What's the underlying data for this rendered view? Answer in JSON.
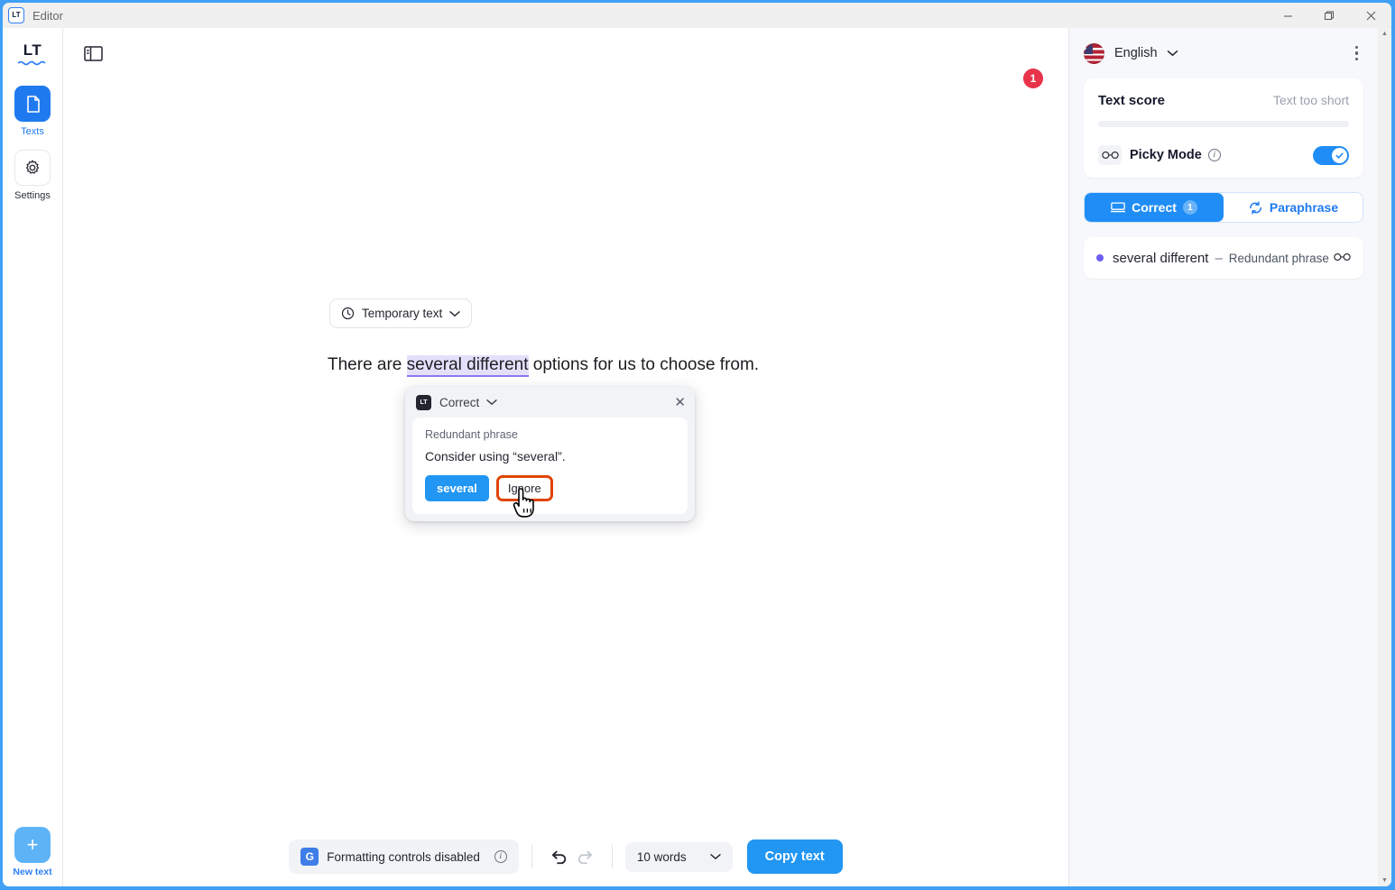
{
  "window": {
    "title": "Editor",
    "app_icon": "LT",
    "controls": {
      "minimize": "—",
      "restore": "❐",
      "close": "✕"
    }
  },
  "rail": {
    "logo": "LT",
    "items": [
      {
        "label": "Texts",
        "icon": "document-icon",
        "active": true
      },
      {
        "label": "Settings",
        "icon": "gear-icon",
        "active": false
      }
    ],
    "new_text": {
      "label": "New text",
      "icon": "plus-icon"
    }
  },
  "editor": {
    "panel_toggle_icon": "sidebar-toggle-icon",
    "notification_badge": "1",
    "temp_chip": {
      "label": "Temporary text",
      "icon": "clock-icon",
      "chevron": "⌄"
    },
    "text_before": "There are ",
    "text_highlight": "several different",
    "text_after": " options for us to choose from."
  },
  "popup": {
    "brand_icon": "LT",
    "title": "Correct",
    "chevron": "⌄",
    "close": "✕",
    "rule_name": "Redundant phrase",
    "message": "Consider using “several”.",
    "suggestion_button": "several",
    "ignore_button": "Ignore"
  },
  "bottombar": {
    "formatting": {
      "icon": "G",
      "label": "Formatting controls disabled",
      "info": "i"
    },
    "undo_icon": "undo-icon",
    "redo_icon": "redo-icon",
    "word_count": {
      "label": "10 words",
      "chevron": "⌄"
    },
    "copy_button": "Copy text"
  },
  "right_panel": {
    "language": "English",
    "language_chevron": "⌄",
    "menu_icon": "kebab-menu-icon",
    "score": {
      "title": "Text score",
      "status": "Text too short",
      "progress_percent": 0
    },
    "picky_mode": {
      "label": "Picky Mode",
      "icon": "glasses-icon",
      "info": "i",
      "enabled": true
    },
    "tabs": [
      {
        "label": "Correct",
        "count": "1",
        "icon": "correct-icon",
        "active": true
      },
      {
        "label": "Paraphrase",
        "count": "",
        "icon": "paraphrase-icon",
        "active": false
      }
    ],
    "suggestions": [
      {
        "phrase": "several different",
        "dash": "–",
        "rule": "Redundant phrase",
        "icon": "glasses-icon"
      }
    ]
  },
  "scrollbar": {
    "up": "▲",
    "down": "▼"
  },
  "colors": {
    "accent_blue": "#2196f3",
    "rail_active": "#1f7af0",
    "badge_red": "#e8334a",
    "highlight_purple": "#e4e0fb",
    "underline_purple": "#8b79f0",
    "suggestion_dot": "#6d5ef0",
    "ignore_outline": "#e04403",
    "window_border": "#3fa0f5"
  }
}
